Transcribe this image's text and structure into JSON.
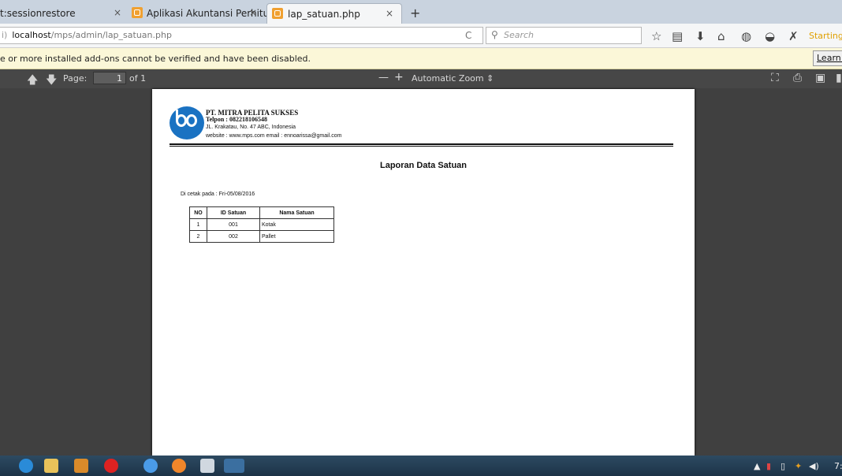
{
  "tabs": [
    {
      "label": "t:sessionrestore",
      "close": "×"
    },
    {
      "label": "Aplikasi Akuntansi Perhitu...",
      "close": "×"
    },
    {
      "label": "lap_satuan.php",
      "close": "×"
    }
  ],
  "new_tab": "+",
  "address": {
    "host": "localhost",
    "path": "/mps/admin/lap_satuan.php",
    "info": "i)"
  },
  "reload": "C",
  "search": {
    "placeholder": "Search"
  },
  "toolbar_status": "Starting...",
  "notification": {
    "message": "e or more installed add-ons cannot be verified and have been disabled.",
    "button": "Learn M"
  },
  "pdf": {
    "page_label": "Page:",
    "page_number": "1",
    "page_of": "of 1",
    "zoom_minus": "—",
    "zoom_plus": "+",
    "zoom": "Automatic Zoom"
  },
  "document": {
    "company": "PT. MITRA PELITA SUKSES",
    "phone": "Telpon : 082218106548",
    "address": "JL. Krakatau, No. 47 ABC, Indonesia",
    "web": "website : www.mps.com email : ennoarissa@gmail.com",
    "title": "Laporan Data Satuan",
    "printed": "Di cetak pada : Fri-05/08/2016",
    "table": {
      "headers": [
        "NO",
        "ID Satuan",
        "Nama Satuan"
      ],
      "rows": [
        [
          "1",
          "001",
          "Kotak"
        ],
        [
          "2",
          "002",
          "Pallet"
        ]
      ]
    }
  },
  "clock": "7:",
  "colors": {
    "accent": "#1a72c2",
    "notification_bg": "#fbf7d8",
    "pdf_toolbar": "#474747"
  }
}
